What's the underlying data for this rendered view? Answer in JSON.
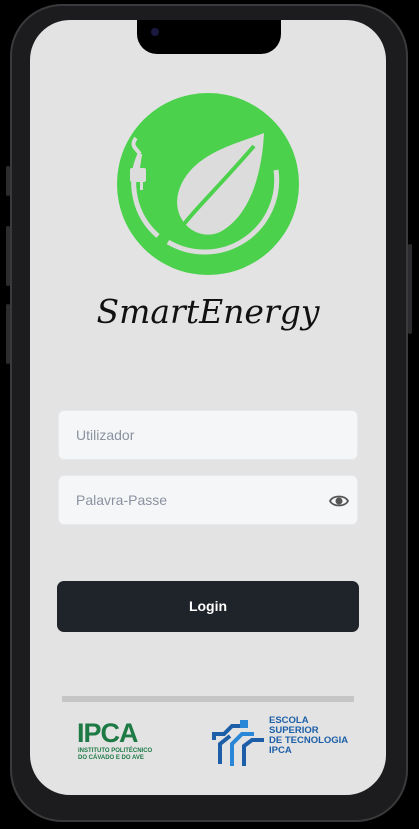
{
  "app": {
    "title": "SmartEnergy"
  },
  "login_form": {
    "username_placeholder": "Utilizador",
    "password_placeholder": "Palavra-Passe",
    "login_label": "Login",
    "password_toggle_icon": "eye-icon"
  },
  "footer": {
    "ipca_logo": {
      "word": "IPCA",
      "line1": "INSTITUTO POLITÉCNICO",
      "line2": "DO CÁVADO E DO AVE"
    },
    "estg_logo": {
      "line1": "ESCOLA",
      "line2": "SUPERIOR",
      "line3": "DE TECNOLOGIA",
      "line4": "IPCA"
    }
  },
  "colors": {
    "logo_green": "#4cd14c",
    "screen_background": "#e3e3e3",
    "button_background": "#1f232a",
    "ipca_green": "#1d7a45",
    "estg_blue": "#1c5fa8"
  },
  "icons": [
    "leaf-plug-icon",
    "eye-icon"
  ]
}
